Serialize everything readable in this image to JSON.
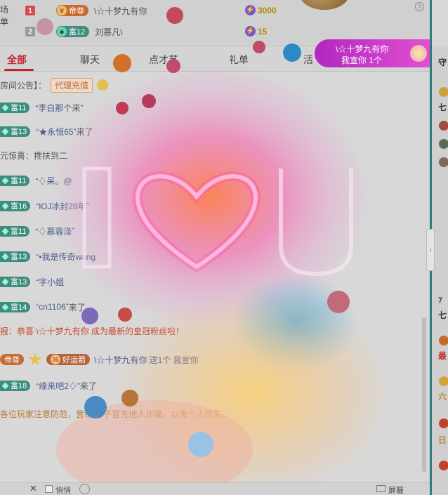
{
  "side_labels": [
    "场",
    "单"
  ],
  "ranking": [
    {
      "rank": "1",
      "badge": "帝尊",
      "name": "\\☆十梦九有你",
      "coins": "3000"
    },
    {
      "rank": "2",
      "badge": "富12",
      "name": "刘慕凡\\",
      "coins": "15"
    }
  ],
  "tabs": [
    {
      "label": "全部"
    },
    {
      "label": "聊天"
    },
    {
      "label": "点才艺"
    },
    {
      "label": "礼单"
    },
    {
      "label": "活"
    }
  ],
  "promo": {
    "line1": "\\☆十梦九有你",
    "line2": "我宣你 1个"
  },
  "right_panel_chars": [
    "守",
    "七",
    "最",
    "六",
    "日"
  ],
  "notice": {
    "label": "房间公告】：",
    "button": "代理充值"
  },
  "messages": [
    {
      "level": "富11",
      "user": "“李白那个",
      "suffix": "来”"
    },
    {
      "level": "富13",
      "user": "“★永恒65”",
      "suffix": "来了"
    },
    {
      "level": "",
      "user": "元惊喜：搀扶",
      "suffix": "到二"
    },
    {
      "level": "富11",
      "user": "“♢呆。@",
      "suffix": ""
    },
    {
      "level": "富16",
      "user": "“ЮЈ冰封28年",
      "suffix": "”"
    },
    {
      "level": "富11",
      "user": "“♢慕蓉泽",
      "suffix": "”"
    },
    {
      "level": "富13",
      "user": "“•我是传奇wang",
      "suffix": ""
    },
    {
      "level": "富13",
      "user": "“字小姐",
      "suffix": ""
    },
    {
      "level": "富14",
      "user": "“cn1106”",
      "suffix": "来了"
    }
  ],
  "announcement": "报：恭喜 \\☆十梦九有你 成为最新的皇冠粉丝啦！",
  "gift_message": {
    "badge": "帝尊",
    "luck_num": "36",
    "luck_label": "好运箭",
    "text": "\\☆十梦九有你 送1个 我宣你"
  },
  "welcome": {
    "level": "富18",
    "user": "“缘来吧2♢”",
    "suffix": "来了"
  },
  "warning": "各位玩家注意防范，营销 分子冒充他人诈骗，以免个人损失。",
  "bottom": {
    "close": "✕",
    "checkbox_label": "悄悄",
    "screen_label": "屏蔽"
  }
}
